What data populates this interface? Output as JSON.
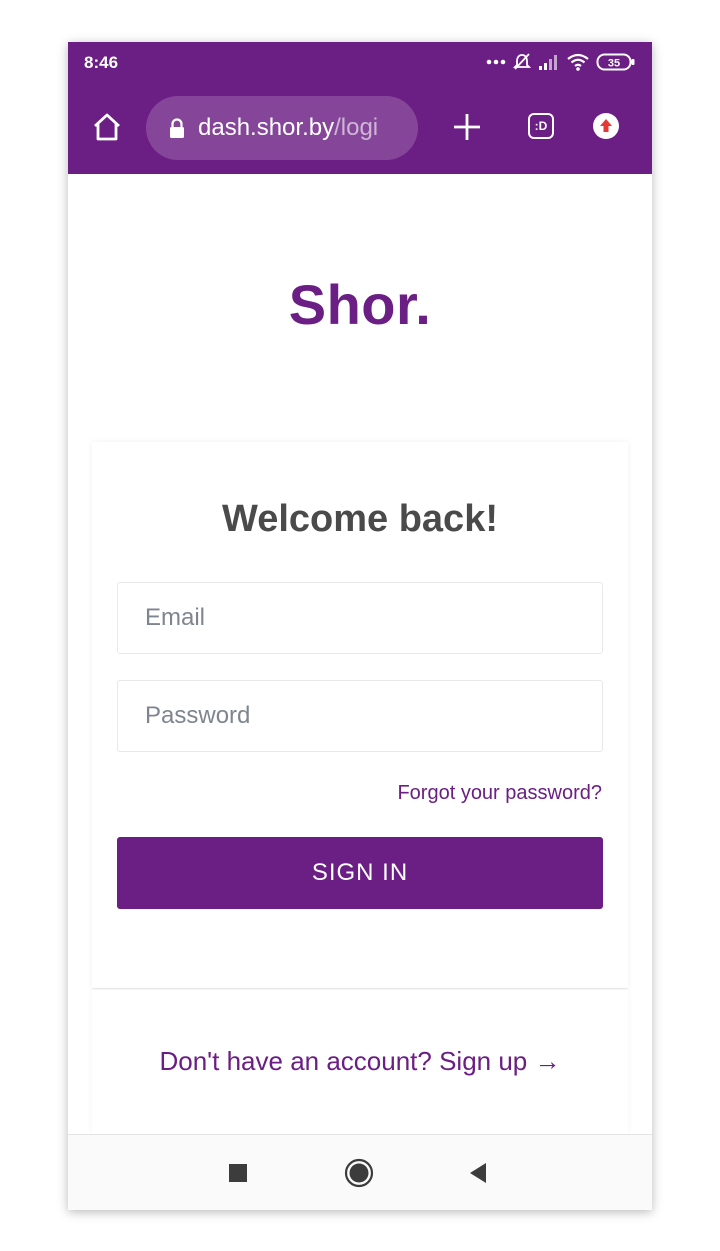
{
  "status_bar": {
    "time": "8:46",
    "battery": "35"
  },
  "browser": {
    "url_host": "dash.shor.by",
    "url_path": "/logi",
    "tab_badge": ":D"
  },
  "brand": {
    "logo": "Shor.",
    "accent_color": "#6b1e83"
  },
  "login": {
    "heading": "Welcome back!",
    "email_placeholder": "Email",
    "password_placeholder": "Password",
    "forgot_label": "Forgot your password?",
    "signin_label": "SIGN IN"
  },
  "signup": {
    "label": "Don't have an account? Sign up →"
  },
  "icons": {
    "home": "home-icon",
    "lock": "lock-icon",
    "new_tab": "plus-icon",
    "tabs": "tabs-icon",
    "upload": "upload-icon",
    "recents": "square-icon",
    "nav_home": "circle-icon",
    "back": "back-triangle-icon"
  }
}
